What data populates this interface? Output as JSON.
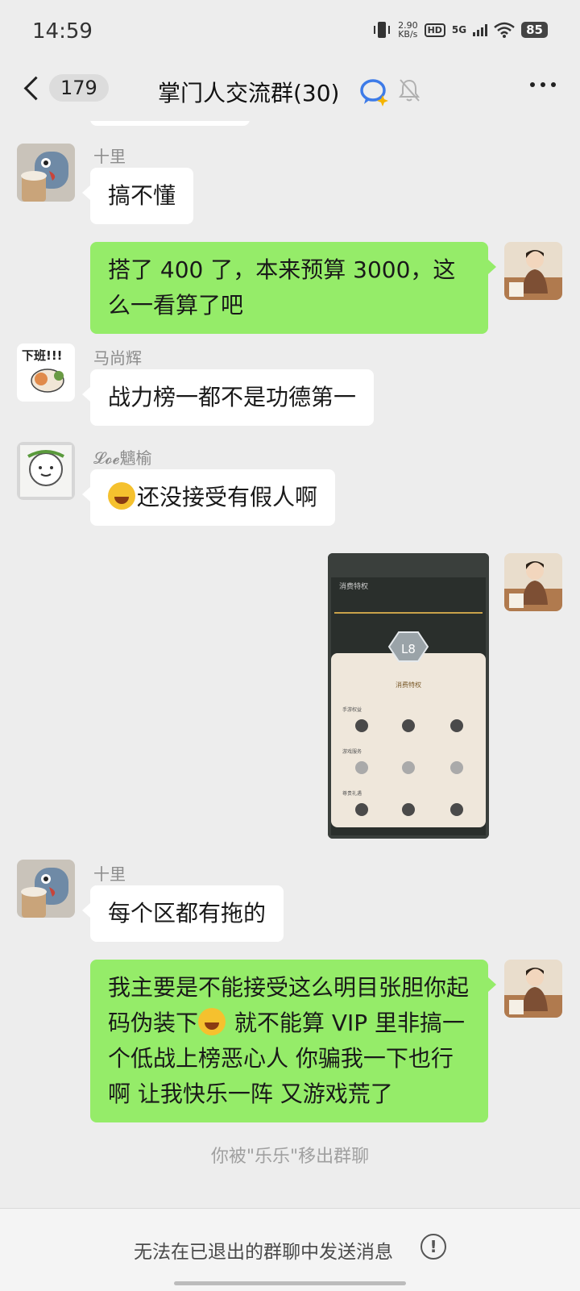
{
  "status_bar": {
    "time": "14:59",
    "net_speed": "2.90",
    "net_unit": "KB/s",
    "hd": "HD",
    "network": "5G",
    "battery": "85"
  },
  "header": {
    "unread_count": "179",
    "title": "掌门人交流群(30)"
  },
  "messages": [
    {
      "sender": "十里",
      "text": "搞不懂"
    },
    {
      "text": "搭了 400 了，本来预算 3000，这么一看算了吧"
    },
    {
      "sender": "马尚辉",
      "text": "战力榜一都不是功德第一"
    },
    {
      "sender": "𝓛𝓸𝓮魑榆",
      "text": "还没接受有假人啊"
    },
    {
      "image_title": "消费特权",
      "image_badge": "L8",
      "image_caption": "消费特权",
      "image_sections": [
        "手游权益",
        "游戏服务",
        "尊贵礼遇"
      ]
    },
    {
      "sender": "十里",
      "text": "每个区都有拖的"
    },
    {
      "text_before_emoji": "我主要是不能接受这么明目张胆你起码伪装下",
      "text_after_emoji": " 就不能算 VIP 里非搞一个低战上榜恶心人 你骗我一下也行啊 让我快乐一阵 又游戏荒了"
    }
  ],
  "system_note": "你被\"乐乐\"移出群聊",
  "bottom_notice": "无法在已退出的群聊中发送消息",
  "avatar_text": {
    "mashanghui": "下班!!!"
  },
  "colors": {
    "background": "#ededed",
    "bubble_self": "#95ec69",
    "bubble_other": "#ffffff"
  }
}
